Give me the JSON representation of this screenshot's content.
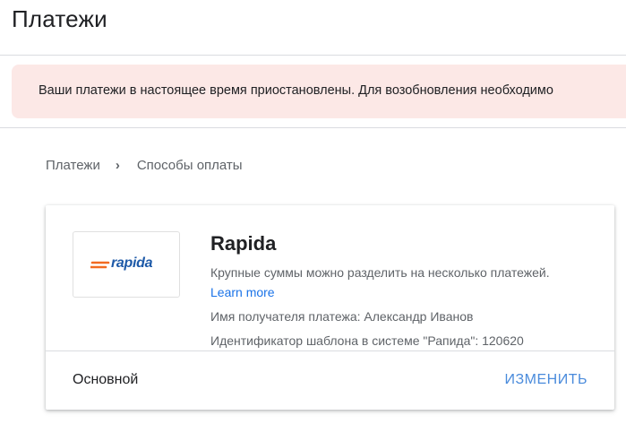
{
  "page": {
    "title": "Платежи"
  },
  "alert": {
    "text": "Ваши платежи в настоящее время приостановлены. Для возобновления необходимо"
  },
  "breadcrumb": {
    "items": [
      "Платежи",
      "Способы оплаты"
    ],
    "separator": "›"
  },
  "payment_method": {
    "logo_text": "rapida",
    "name": "Rapida",
    "description": "Крупные суммы можно разделить на несколько платежей.",
    "learn_more": "Learn more",
    "recipient": "Имя получателя платежа: Александр Иванов",
    "template_id": "Идентификатор шаблона в системе \"Рапида\": 120620",
    "status": "Основной",
    "edit_label": "ИЗМЕНИТЬ"
  },
  "colors": {
    "alert_bg": "#fce8e6",
    "link": "#1a73e8",
    "edit_button": "#4a8bdc",
    "rapida_blue": "#1e5aa8",
    "rapida_orange": "#f26b21"
  }
}
